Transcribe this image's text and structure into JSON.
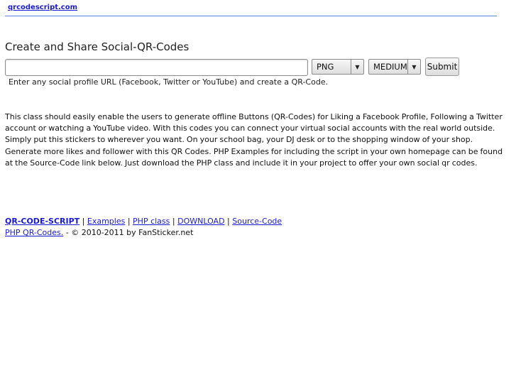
{
  "header": {
    "site_link": "qrcodescript.com"
  },
  "form": {
    "heading": "Create and Share Social-QR-Codes",
    "url_value": "",
    "format_selected": "PNG",
    "size_selected": "MEDIUM",
    "submit_label": "Submit",
    "hint": "Enter any social profile URL (Facebook, Twitter or YouTube) and create a QR-Code.",
    "select_arrow_icon": "triangle-down-icon"
  },
  "description": "This class should easily enable the users to generate offline Buttons (QR-Codes) for Liking a Facebook Profile, Following a Twitter account or watching a YouTube video. With this codes you can connect your virtual social accounts with the real world outside. Simply put this stickers to wherever you want. On your school bag, your DJ desk or to the shopping window of your shop. Generate more likes and follower with this QR Codes. PHP Examples for including the script in your own homepage can be found at the Source-Code link below. Just download the PHP class and include it in your project to offer your own social qr codes.",
  "footer": {
    "links": [
      "QR-CODE-SCRIPT",
      "Examples",
      "PHP class",
      "DOWNLOAD",
      "Source-Code"
    ],
    "separator": "|",
    "line2_link": "PHP QR-Codes.",
    "line2_text": "- © 2010-2011 by FanSticker.net"
  },
  "colors": {
    "link": "#1a1ad6",
    "rule": "#5b84d6"
  }
}
